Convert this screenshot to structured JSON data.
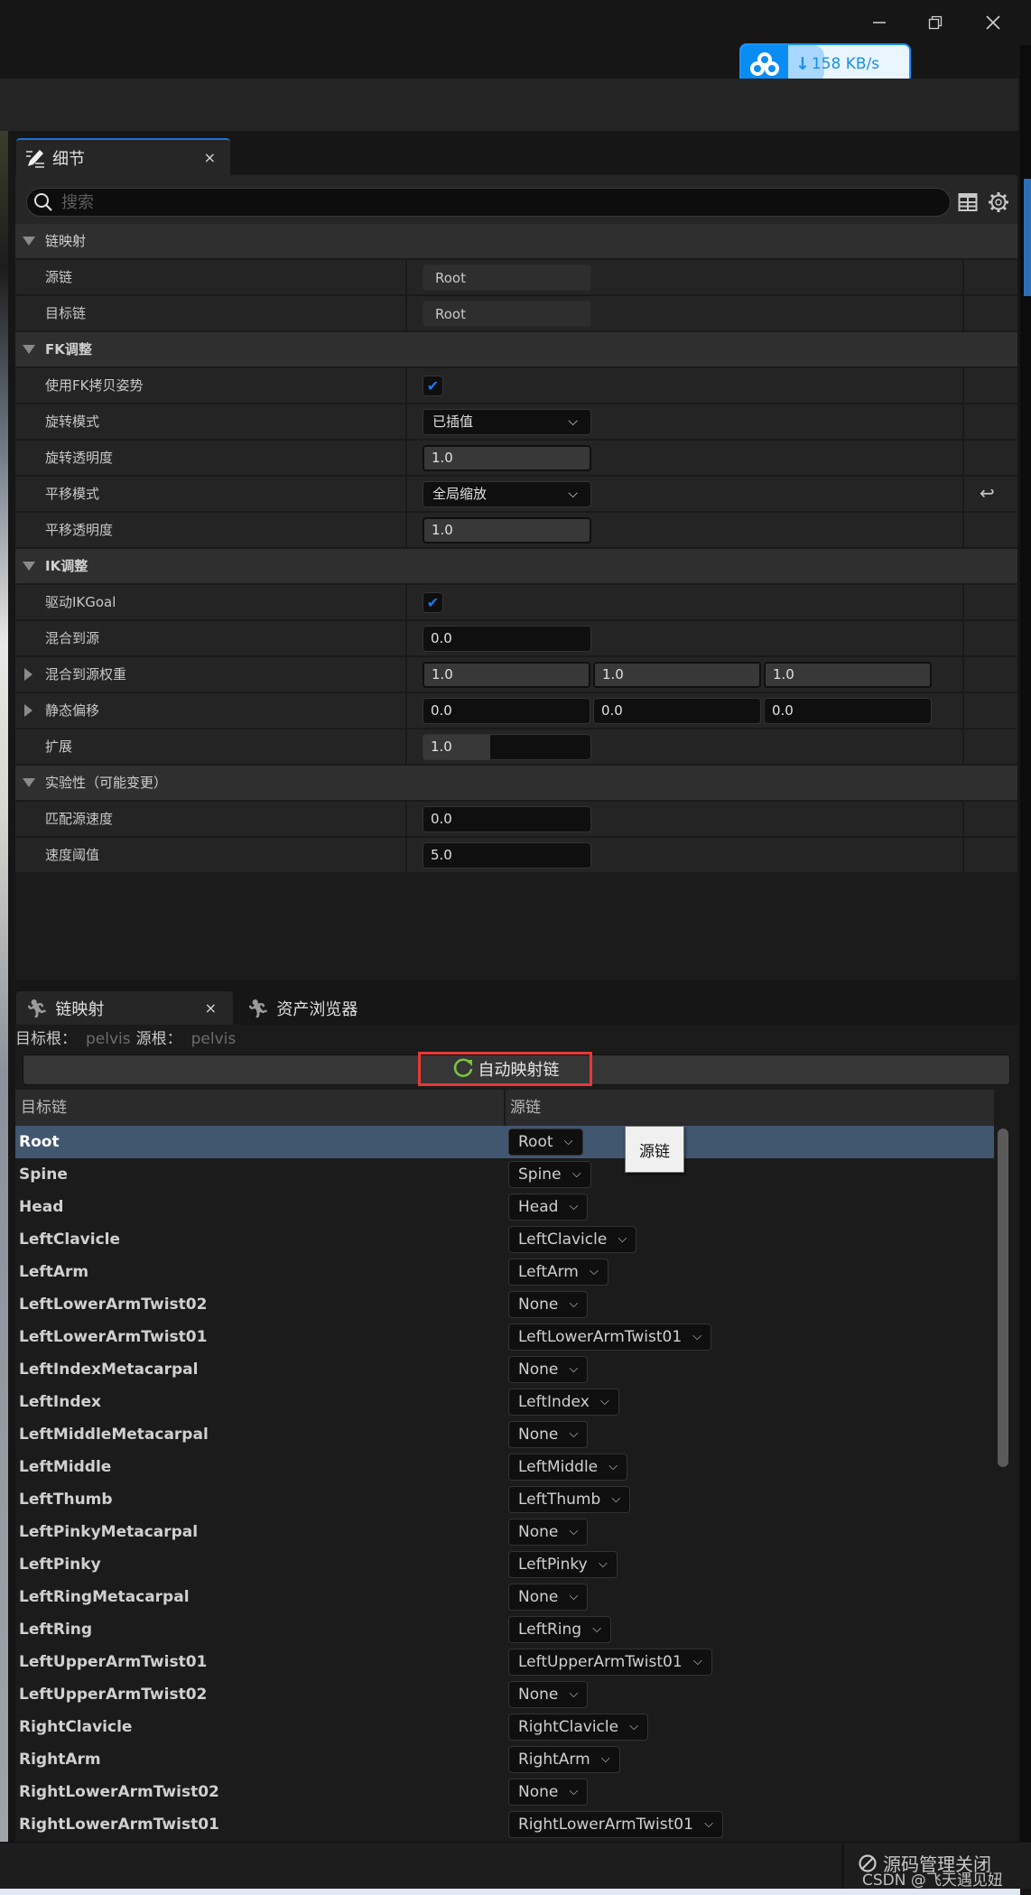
{
  "window": {
    "controls": {
      "minimize": "minimize-icon",
      "restore": "restore-icon",
      "close": "close-icon"
    },
    "download_badge": {
      "icon": "cloud-logo-icon",
      "arrow": "↓",
      "speed": "158 KB/s"
    }
  },
  "details": {
    "tab": {
      "icon": "edit-pencil-icon",
      "label": "细节",
      "close": "×"
    },
    "search": {
      "placeholder": "搜索",
      "value": ""
    },
    "toolbar_icons": [
      "table-view-icon",
      "settings-gear-icon"
    ],
    "categories": {
      "chain_mapping": {
        "label": "链映射",
        "rows": [
          {
            "label": "源链",
            "value": "Root"
          },
          {
            "label": "目标链",
            "value": "Root"
          }
        ]
      },
      "fk": {
        "label": "FK调整",
        "rows": [
          {
            "label": "使用FK拷贝姿势",
            "checked": true
          },
          {
            "label": "旋转模式",
            "value": "已插值"
          },
          {
            "label": "旋转透明度",
            "value": "1.0"
          },
          {
            "label": "平移模式",
            "value": "全局缩放",
            "reset_icon": "reset-arrow-icon"
          },
          {
            "label": "平移透明度",
            "value": "1.0"
          }
        ]
      },
      "ik": {
        "label": "IK调整",
        "rows": [
          {
            "label": "驱动IKGoal",
            "checked": true
          },
          {
            "label": "混合到源",
            "value": "0.0"
          },
          {
            "label": "混合到源权重",
            "values": [
              "1.0",
              "1.0",
              "1.0"
            ]
          },
          {
            "label": "静态偏移",
            "values": [
              "0.0",
              "0.0",
              "0.0"
            ]
          },
          {
            "label": "扩展",
            "value": "1.0",
            "fill_fraction": 0.4
          }
        ]
      },
      "experimental": {
        "label": "实验性（可能变更）",
        "rows": [
          {
            "label": "匹配源速度",
            "value": "0.0"
          },
          {
            "label": "速度阈值",
            "value": "5.0"
          }
        ]
      }
    }
  },
  "chain_panel": {
    "tabs": [
      {
        "label": "链映射",
        "icon": "running-figure-icon",
        "close": "×",
        "active": true
      },
      {
        "label": "资产浏览器",
        "icon": "running-figure-icon",
        "active": false
      }
    ],
    "target_root_label": "目标根：",
    "target_root_value": "pelvis",
    "source_root_label": "源根：",
    "source_root_value": "pelvis",
    "auto_map_button": {
      "icon": "refresh-icon",
      "label": "自动映射链",
      "icon_color": "#7ac143",
      "highlight_color": "#e53935"
    },
    "columns": {
      "target": "目标链",
      "source": "源链"
    },
    "tooltip": "源链",
    "rows": [
      {
        "target": "Root",
        "source": "Root",
        "selected": true
      },
      {
        "target": "Spine",
        "source": "Spine"
      },
      {
        "target": "Head",
        "source": "Head"
      },
      {
        "target": "LeftClavicle",
        "source": "LeftClavicle"
      },
      {
        "target": "LeftArm",
        "source": "LeftArm"
      },
      {
        "target": "LeftLowerArmTwist02",
        "source": "None"
      },
      {
        "target": "LeftLowerArmTwist01",
        "source": "LeftLowerArmTwist01"
      },
      {
        "target": "LeftIndexMetacarpal",
        "source": "None"
      },
      {
        "target": "LeftIndex",
        "source": "LeftIndex"
      },
      {
        "target": "LeftMiddleMetacarpal",
        "source": "None"
      },
      {
        "target": "LeftMiddle",
        "source": "LeftMiddle"
      },
      {
        "target": "LeftThumb",
        "source": "LeftThumb"
      },
      {
        "target": "LeftPinkyMetacarpal",
        "source": "None"
      },
      {
        "target": "LeftPinky",
        "source": "LeftPinky"
      },
      {
        "target": "LeftRingMetacarpal",
        "source": "None"
      },
      {
        "target": "LeftRing",
        "source": "LeftRing"
      },
      {
        "target": "LeftUpperArmTwist01",
        "source": "LeftUpperArmTwist01"
      },
      {
        "target": "LeftUpperArmTwist02",
        "source": "None"
      },
      {
        "target": "RightClavicle",
        "source": "RightClavicle"
      },
      {
        "target": "RightArm",
        "source": "RightArm"
      },
      {
        "target": "RightLowerArmTwist02",
        "source": "None"
      },
      {
        "target": "RightLowerArmTwist01",
        "source": "RightLowerArmTwist01"
      }
    ]
  },
  "status_bar": {
    "source_control_icon": "disabled-circle-icon",
    "source_control_label": "源码管理关闭"
  },
  "watermark": "CSDN @飞天遇见妞",
  "colors": {
    "accent": "#1f6fd1",
    "selected_row": "#41566f",
    "checkbox": "#1e78f0",
    "badge": "#0a8cf5"
  }
}
